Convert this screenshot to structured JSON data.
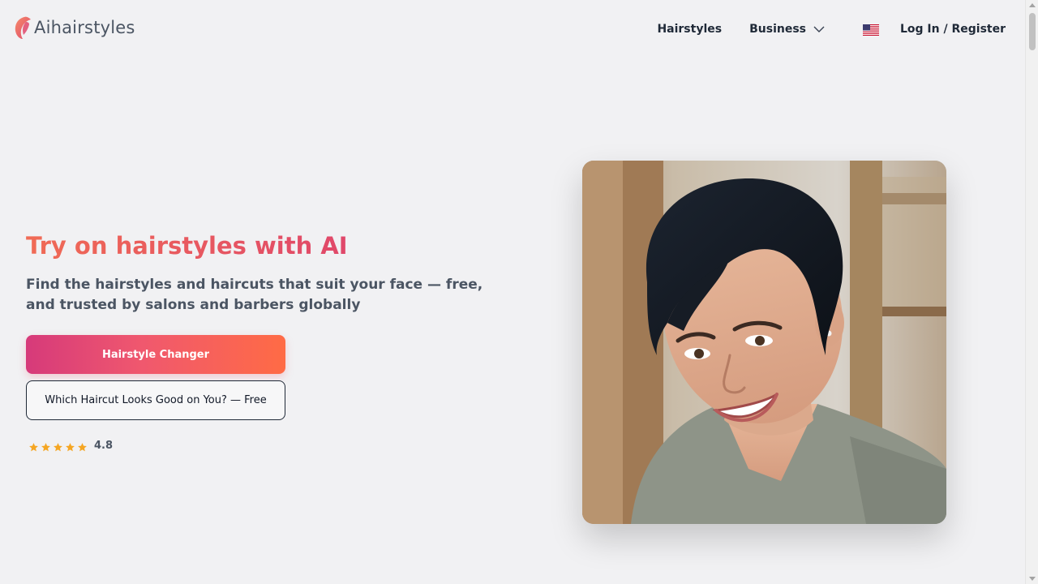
{
  "brand": {
    "name": "Aihairstyles",
    "colors": {
      "accent_start": "#d63a7a",
      "accent_end": "#ff6b45",
      "title": "#e85a5f"
    }
  },
  "nav": {
    "hairstyles": "Hairstyles",
    "business": "Business",
    "language_icon": "us-flag-icon",
    "login": "Log In / Register"
  },
  "hero": {
    "title": "Try on hairstyles with AI",
    "subtitle": "Find the hairstyles and haircuts that suit your face — free, and trusted by salons and barbers globally",
    "primary_cta": "Hairstyle Changer",
    "secondary_cta": "Which Haircut Looks Good on You? — Free",
    "rating": {
      "stars": 5,
      "value": "4.8"
    }
  }
}
